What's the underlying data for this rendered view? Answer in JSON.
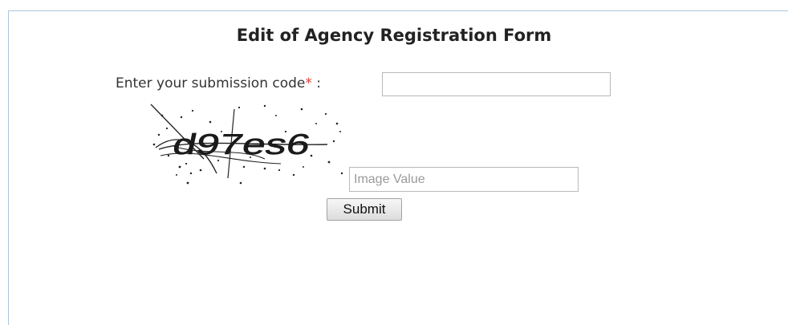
{
  "form": {
    "title": "Edit of Agency Registration Form",
    "code_label": "Enter your submission code",
    "required_mark": "*",
    "label_separator": " :",
    "code_value": "",
    "captcha_text": "d97es6",
    "image_value_placeholder": "Image Value",
    "image_value": "",
    "submit_label": "Submit"
  },
  "colors": {
    "required": "#e03a3a",
    "panel_border": "#a9c4de"
  }
}
